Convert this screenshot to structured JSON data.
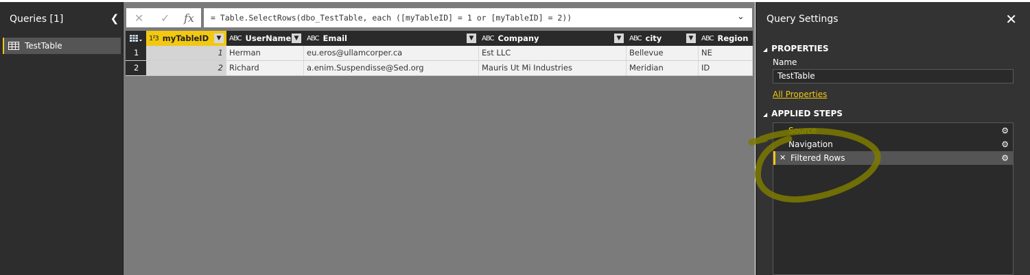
{
  "queries": {
    "title": "Queries [1]",
    "items": [
      {
        "label": "TestTable"
      }
    ]
  },
  "formula": {
    "text": "= Table.SelectRows(dbo_TestTable, each ([myTableID] = 1 or [myTableID] = 2))"
  },
  "grid": {
    "columns": [
      {
        "type": "1²3",
        "label": "myTableID"
      },
      {
        "type": "ABC",
        "label": "UserName"
      },
      {
        "type": "ABC",
        "label": "Email"
      },
      {
        "type": "ABC",
        "label": "Company"
      },
      {
        "type": "ABC",
        "label": "city"
      },
      {
        "type": "ABC",
        "label": "Region"
      }
    ],
    "rows": [
      {
        "num": "1",
        "cells": [
          "1",
          "Herman",
          "eu.eros@ullamcorper.ca",
          "Est LLC",
          "Bellevue",
          "NE"
        ]
      },
      {
        "num": "2",
        "cells": [
          "2",
          "Richard",
          "a.enim.Suspendisse@Sed.org",
          "Mauris Ut Mi Industries",
          "Meridian",
          "ID"
        ]
      }
    ]
  },
  "settings": {
    "title": "Query Settings",
    "properties_header": "PROPERTIES",
    "name_label": "Name",
    "name_value": "TestTable",
    "all_properties": "All Properties",
    "steps_header": "APPLIED STEPS",
    "steps": [
      {
        "label": "Source"
      },
      {
        "label": "Navigation"
      },
      {
        "label": "Filtered Rows"
      }
    ]
  },
  "colors": {
    "accent": "#f2c811",
    "annotation": "#8a8a00"
  }
}
